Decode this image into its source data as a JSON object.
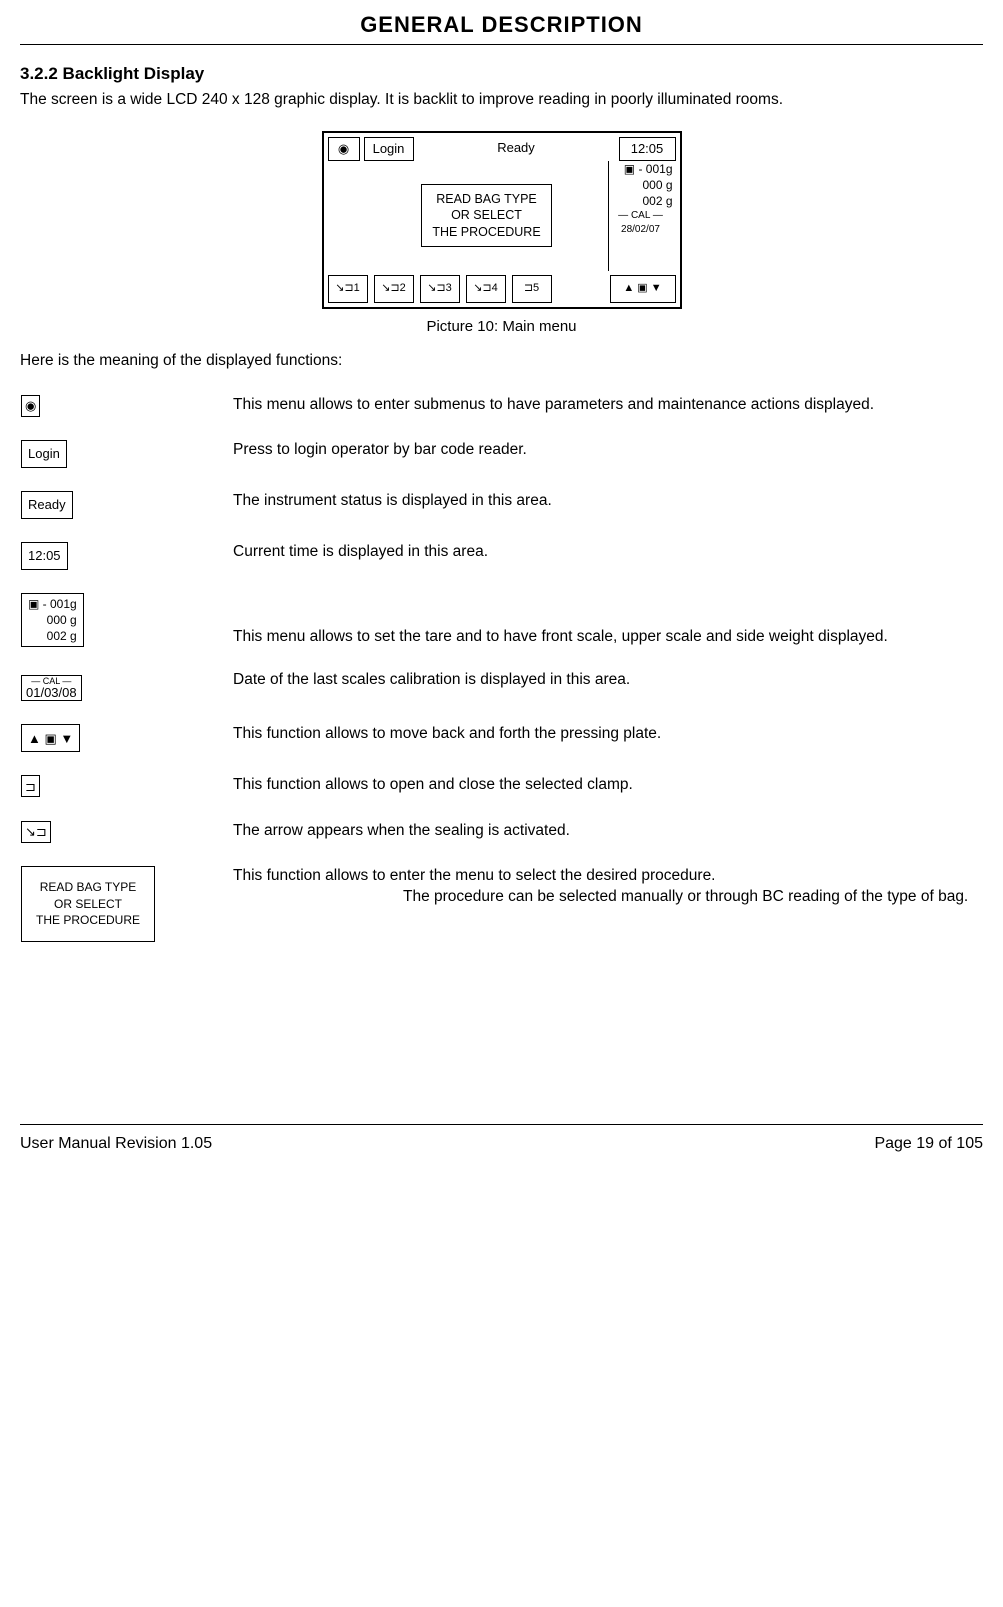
{
  "header": "GENERAL DESCRIPTION",
  "section": {
    "num": "3.2.2",
    "title": "Backlight Display"
  },
  "intro": "The screen is a wide LCD 240 x 128 graphic display. It is backlit to improve reading in poorly illuminated rooms.",
  "lcd": {
    "login": "Login",
    "ready": "Ready",
    "time": "12:05",
    "msg_l1": "READ BAG TYPE",
    "msg_l2": "OR SELECT",
    "msg_l3": "THE PROCEDURE",
    "w1": "- 001g",
    "w2": "000 g",
    "w3": "002 g",
    "cal_label": "CAL",
    "cal_date": "28/02/07",
    "b1": "1",
    "b2": "2",
    "b3": "3",
    "b4": "4",
    "b5": "5"
  },
  "caption": "Picture 10: Main menu",
  "intro2": "Here is the meaning of the displayed functions:",
  "fn": {
    "eye": "This menu allows to enter submenus to have parameters and maintenance actions displayed.",
    "login_label": "Login",
    "login": "Press to login operator by bar code reader.",
    "ready_label": "Ready",
    "ready": "The instrument status is displayed in this area.",
    "time_label": "12:05",
    "time": "Current time is displayed in this area.",
    "weight_l1": "- 001g",
    "weight_l2": "000 g",
    "weight_l3": "002 g",
    "weight": "This menu allows to set the tare and to have front scale, upper scale and side weight displayed.",
    "cal_label": "CAL",
    "cal_date": "01/03/08",
    "cal": "Date of the last scales calibration is displayed in this area.",
    "plate": "This function allows to move back and forth the pressing plate.",
    "clamp": "This function allows to open and close the selected clamp.",
    "seal": "The arrow appears when the sealing is activated.",
    "proc_l1": "READ BAG TYPE",
    "proc_l2": "OR SELECT",
    "proc_l3": "THE PROCEDURE",
    "proc_a": "This function allows to enter the menu to select the desired procedure.",
    "proc_b": "The procedure can be selected manually or through BC reading of the type of bag."
  },
  "footer": {
    "left": "User Manual Revision 1.05",
    "right": "Page 19 of 105"
  }
}
